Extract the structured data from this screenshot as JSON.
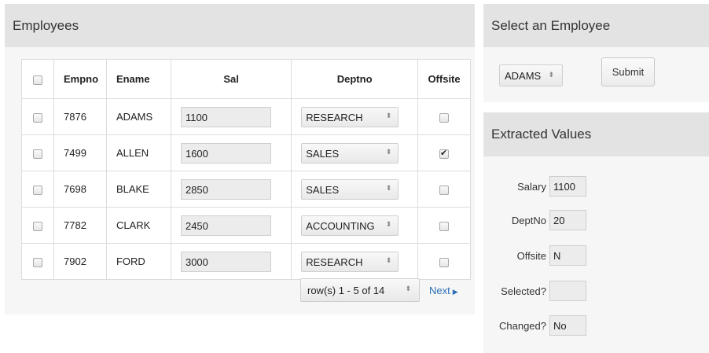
{
  "employees_panel": {
    "title": "Employees",
    "columns": [
      "Empno",
      "Ename",
      "Sal",
      "Deptno",
      "Offsite"
    ],
    "rows": [
      {
        "empno": "7876",
        "ename": "ADAMS",
        "sal": "1100",
        "deptno": "RESEARCH",
        "offsite": false
      },
      {
        "empno": "7499",
        "ename": "ALLEN",
        "sal": "1600",
        "deptno": "SALES",
        "offsite": true
      },
      {
        "empno": "7698",
        "ename": "BLAKE",
        "sal": "2850",
        "deptno": "SALES",
        "offsite": false
      },
      {
        "empno": "7782",
        "ename": "CLARK",
        "sal": "2450",
        "deptno": "ACCOUNTING",
        "offsite": false
      },
      {
        "empno": "7902",
        "ename": "FORD",
        "sal": "3000",
        "deptno": "RESEARCH",
        "offsite": false
      }
    ],
    "pagination": {
      "range_label": "row(s) 1 - 5 of 14",
      "next_label": "Next"
    }
  },
  "select_panel": {
    "title": "Select an Employee",
    "selected_employee": "ADAMS",
    "submit_label": "Submit"
  },
  "extracted_panel": {
    "title": "Extracted Values",
    "fields": [
      {
        "label": "Salary",
        "value": "1100"
      },
      {
        "label": "DeptNo",
        "value": "20"
      },
      {
        "label": "Offsite",
        "value": "N"
      },
      {
        "label": "Selected?",
        "value": ""
      },
      {
        "label": "Changed?",
        "value": "No"
      }
    ]
  },
  "colors": {
    "header_bg": "#e3e3e3",
    "panel_bg": "#f6f6f6",
    "link": "#2a6fb5"
  }
}
